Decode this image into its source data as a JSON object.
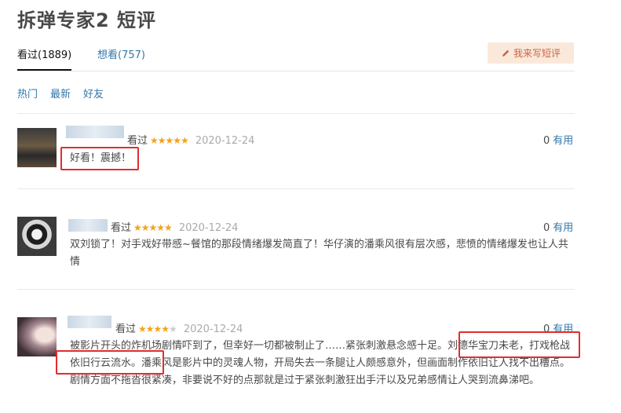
{
  "page": {
    "title": "拆弹专家2 短评"
  },
  "tabs": [
    {
      "label": "看过(1889)"
    },
    {
      "label": "想看(757)"
    }
  ],
  "write_button": {
    "label": "我来写短评"
  },
  "filters": [
    {
      "label": "热门"
    },
    {
      "label": "最新"
    },
    {
      "label": "好友"
    }
  ],
  "comments": [
    {
      "watched_label": "看过",
      "stars": 5,
      "stars_text": "★★★★★",
      "date": "2020-12-24",
      "useful_count": "0",
      "useful_label": "有用",
      "text": "好看！震撼！"
    },
    {
      "watched_label": "看过",
      "stars": 5,
      "stars_text": "★★★★★",
      "date": "2020-12-24",
      "useful_count": "0",
      "useful_label": "有用",
      "text": "双刘锁了！对手戏好带感~餐馆的那段情绪爆发简直了！华仔演的潘乘风很有层次感，悲愤的情绪爆发也让人共情"
    },
    {
      "watched_label": "看过",
      "stars": 4,
      "stars_text": "★★★★",
      "stars_empty": "★",
      "date": "2020-12-24",
      "useful_count": "0",
      "useful_label": "有用",
      "text": "被影片开头的炸机场剧情吓到了，但幸好一切都被制止了……紧张刺激悬念感十足。刘德华宝刀未老，打戏枪战依旧行云流水。潘乘风是影片中的灵魂人物，开局失去一条腿让人颇感意外，但画面制作依旧让人找不出槽点。剧情方面不拖沓很紧凑，非要说不好的点那就是过于紧张刺激狂出手汗以及兄弟感情让人哭到流鼻涕吧。"
    }
  ],
  "colors": {
    "link": "#3377aa",
    "star": "#f4a21a",
    "highlight": "#e22d2d",
    "write_button_bg": "#fae9da"
  }
}
